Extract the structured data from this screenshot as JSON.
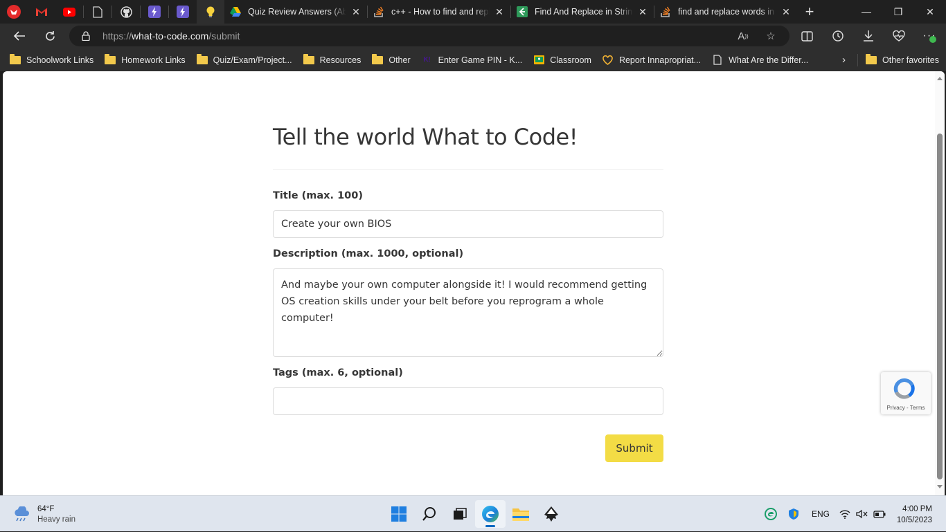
{
  "browser": {
    "pinned_tabs": [
      {
        "name": "app-icon"
      },
      {
        "name": "gmail-icon"
      },
      {
        "name": "youtube-icon"
      },
      {
        "name": "page-icon"
      },
      {
        "name": "github-icon"
      },
      {
        "name": "bolt-icon"
      },
      {
        "name": "bolt-icon"
      },
      {
        "name": "lightbulb-icon"
      }
    ],
    "tabs": [
      {
        "title": "Quiz Review Answers (Absolute Value)",
        "icon": "google-drive-icon"
      },
      {
        "title": "c++ - How to find and replace string",
        "icon": "stackoverflow-icon"
      },
      {
        "title": "Find And Replace in String - LeetCode",
        "icon": "leetcode-icon"
      },
      {
        "title": "find and replace words in C++",
        "icon": "stackoverflow-icon"
      }
    ],
    "address": {
      "prefix": "https://",
      "domain": "what-to-code.com",
      "path": "/submit"
    },
    "bookmarks": [
      {
        "label": "Schoolwork Links",
        "type": "folder"
      },
      {
        "label": "Homework Links",
        "type": "folder"
      },
      {
        "label": "Quiz/Exam/Project...",
        "type": "folder"
      },
      {
        "label": "Resources",
        "type": "folder"
      },
      {
        "label": "Other",
        "type": "folder"
      },
      {
        "label": "Enter Game PIN - K...",
        "type": "kahoot"
      },
      {
        "label": "Classroom",
        "type": "classroom"
      },
      {
        "label": "Report Innapropriat...",
        "type": "heart"
      },
      {
        "label": "What Are the Differ...",
        "type": "page"
      }
    ],
    "other_favorites": "Other favorites"
  },
  "page": {
    "heading": "Tell the world What to Code!",
    "title_label": "Title (max. 100)",
    "title_value": "Create your own BIOS",
    "description_label": "Description (max. 1000, optional)",
    "description_value": "And maybe your own computer alongside it! I would recommend getting OS creation skills under your belt before you reprogram a whole computer!",
    "tags_label": "Tags (max. 6, optional)",
    "tags_value": "",
    "submit_label": "Submit",
    "accent_color": "#f3dc45",
    "recaptcha_text": "Privacy - Terms"
  },
  "taskbar": {
    "temperature": "64°F",
    "condition": "Heavy rain",
    "language": "ENG",
    "time": "4:00 PM",
    "date": "10/5/2023"
  }
}
